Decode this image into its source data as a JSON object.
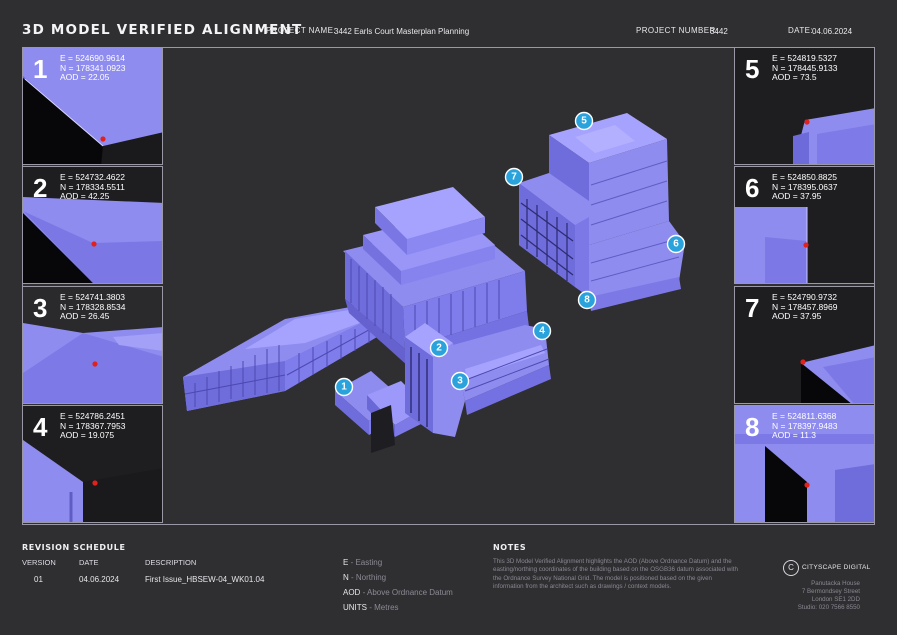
{
  "header": {
    "title": "3D MODEL VERIFIED ALIGNMENT",
    "project_name_label": "PROJECT NAME:",
    "project_name": "3442 Earls Court Masterplan Planning",
    "project_number_label": "PROJECT NUMBER:",
    "project_number": "3442",
    "date_label": "DATE:",
    "date": "04.06.2024"
  },
  "points": [
    {
      "num": "1",
      "e": "E = 524690.9614",
      "n": "N = 178341.0923",
      "aod": "AOD = 22.05"
    },
    {
      "num": "2",
      "e": "E = 524732.4622",
      "n": "N = 178334.5511",
      "aod": "AOD = 42.25"
    },
    {
      "num": "3",
      "e": "E = 524741.3803",
      "n": "N = 178328.8534",
      "aod": "AOD = 26.45"
    },
    {
      "num": "4",
      "e": "E = 524786.2451",
      "n": "N = 178367.7953",
      "aod": "AOD = 19.075"
    },
    {
      "num": "5",
      "e": "E = 524819.5327",
      "n": "N = 178445.9133",
      "aod": "AOD = 73.5"
    },
    {
      "num": "6",
      "e": "E = 524850.8825",
      "n": "N = 178395.0637",
      "aod": "AOD = 37.95"
    },
    {
      "num": "7",
      "e": "E = 524790.9732",
      "n": "N = 178457.8969",
      "aod": "AOD = 37.95"
    },
    {
      "num": "8",
      "e": "E = 524811.6368",
      "n": "N = 178397.9483",
      "aod": "AOD = 11.3"
    }
  ],
  "revision": {
    "title": "REVISION SCHEDULE",
    "col_version": "VERSION",
    "col_date": "DATE",
    "col_description": "DESCRIPTION",
    "rows": [
      {
        "version": "01",
        "date": "04.06.2024",
        "description": "First Issue_HBSEW-04_WK01.04"
      }
    ]
  },
  "legend": [
    {
      "key": "E",
      "value": " - Easting"
    },
    {
      "key": "N",
      "value": " - Northing"
    },
    {
      "key": "AOD",
      "value": " - Above Ordnance Datum"
    },
    {
      "key": "UNITS",
      "value": " - Metres"
    }
  ],
  "notes": {
    "title": "NOTES",
    "text": "This 3D Model Verified Alignment highlights the AOD (Above Ordnance Datum) and the easting/northing coordinates of the building based on the OSGB36 datum associated with the Ordnance Survey National Grid. The model is positioned based on the given information from the architect such as drawings / context models."
  },
  "company": {
    "logo_letter": "C",
    "name": "CITYSCAPE DIGITAL",
    "address": [
      "Panutacka House",
      "7 Bermondsey Street",
      "London SE1 2DD",
      "Studio: 020 7566 8550"
    ]
  },
  "colors": {
    "background": "#2f2e31",
    "model": "#8f8cf0",
    "model_dark": "#5f5cc4",
    "marker": "#2aa3dd",
    "point": "#e2211c"
  }
}
